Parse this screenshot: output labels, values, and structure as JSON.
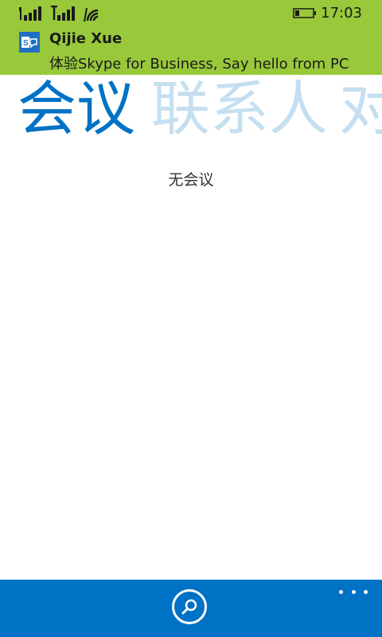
{
  "status_bar": {
    "time": "17:03",
    "icons": [
      "signal-bars-icon",
      "signal-bars-sim2-icon",
      "wifi-icon",
      "battery-icon"
    ]
  },
  "toast": {
    "app_icon": "skype-for-business-icon",
    "sender": "Qijie Xue",
    "message": "体验Skype for Business, Say hello from PC"
  },
  "pivot": {
    "items": [
      {
        "label": "会议",
        "active": true
      },
      {
        "label": "联系人",
        "active": false
      },
      {
        "label": "对",
        "active": false
      }
    ]
  },
  "main": {
    "empty_text": "无会议"
  },
  "appbar": {
    "search_icon": "search-icon",
    "more_icon": "more-icon"
  },
  "colors": {
    "accent": "#0072c6",
    "toast_bg": "#99c93b",
    "pivot_inactive": "#c4dff0"
  }
}
